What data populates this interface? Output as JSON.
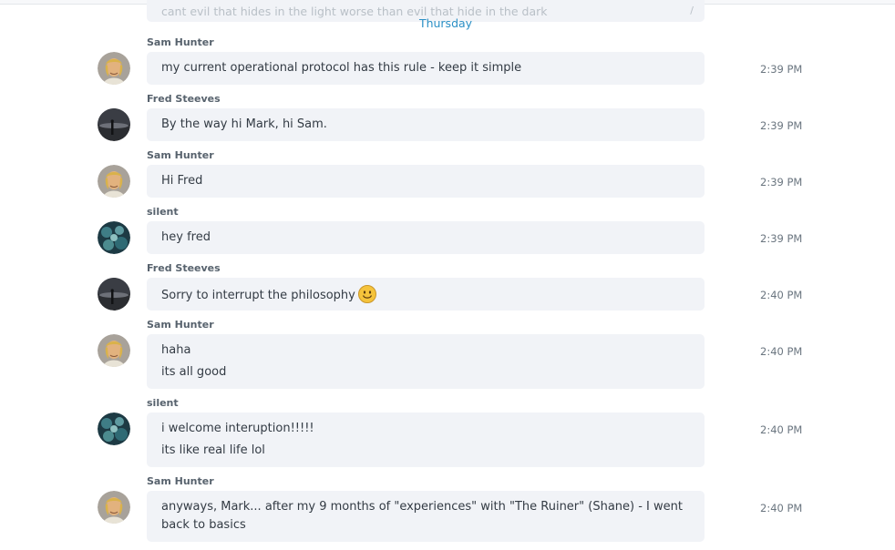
{
  "chat": {
    "previous_message_fragment": "cant evil that hides in the light worse than evil that hide in the dark",
    "day_separator": "Thursday",
    "messages": [
      {
        "author": "Sam Hunter",
        "avatar": "sam-hunter-avatar",
        "lines": [
          "my current operational protocol has this rule - keep it simple"
        ],
        "time": "2:39 PM"
      },
      {
        "author": "Fred Steeves",
        "avatar": "fred-steeves-avatar",
        "lines": [
          "By the way hi Mark, hi Sam."
        ],
        "time": "2:39 PM"
      },
      {
        "author": "Sam Hunter",
        "avatar": "sam-hunter-avatar",
        "lines": [
          "Hi Fred"
        ],
        "time": "2:39 PM"
      },
      {
        "author": "silent",
        "avatar": "silent-avatar",
        "lines": [
          "hey fred"
        ],
        "time": "2:39 PM"
      },
      {
        "author": "Fred Steeves",
        "avatar": "fred-steeves-avatar",
        "lines": [
          "Sorry to interrupt the philosophy"
        ],
        "emoji": "smile-emoji",
        "time": "2:40 PM"
      },
      {
        "author": "Sam Hunter",
        "avatar": "sam-hunter-avatar",
        "lines": [
          "haha",
          "its all good"
        ],
        "time": "2:40 PM"
      },
      {
        "author": "silent",
        "avatar": "silent-avatar",
        "lines": [
          "i welcome interuption!!!!!",
          "its like real life lol"
        ],
        "time": "2:40 PM"
      },
      {
        "author": "Sam Hunter",
        "avatar": "sam-hunter-avatar",
        "lines": [
          "anyways, Mark... after my 9 months of \"experiences\" with \"The Ruiner\" (Shane) - I went back to basics"
        ],
        "time": "2:40 PM"
      }
    ]
  },
  "colors": {
    "bubble_background": "#f1f3f7",
    "day_separator": "#2a8fc5",
    "author_name": "#57626d",
    "timestamp": "#6b7680",
    "message_text": "#333b44"
  }
}
